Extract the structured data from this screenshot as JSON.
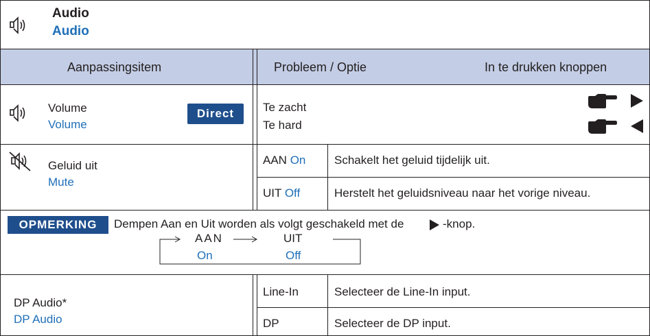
{
  "section": {
    "title": "Audio",
    "title_translation": "Audio"
  },
  "table_headers": {
    "adjustment_item": "Aanpassingsitem",
    "problem_option": "Probleem / Optie",
    "buttons": "In te drukken knoppen"
  },
  "volume": {
    "label": "Volume",
    "label_translation": "Volume",
    "direct_badge": "Direct",
    "options": [
      "Te zacht",
      "Te hard"
    ],
    "icons": [
      "pointing-hand-icon",
      "triangle-right-icon",
      "pointing-hand-icon",
      "triangle-left-icon"
    ]
  },
  "mute": {
    "label": "Geluid uit",
    "label_translation": "Mute",
    "rows": [
      {
        "option": "AAN",
        "option_translation": "On",
        "description": "Schakelt het geluid tijdelijk uit."
      },
      {
        "option": "UIT",
        "option_translation": "Off",
        "description": "Herstelt het geluidsniveau naar het vorige niveau."
      }
    ]
  },
  "note": {
    "badge": "OPMERKING",
    "text_before": "Dempen Aan en Uit worden als volgt geschakeld met de",
    "text_after": "-knop.",
    "cycle": [
      {
        "label": "AAN",
        "translation": "On"
      },
      {
        "label": "UIT",
        "translation": "Off"
      }
    ]
  },
  "dp_audio": {
    "label": "DP Audio*",
    "label_translation": "DP Audio",
    "rows": [
      {
        "option": "Line-In",
        "description": "Selecteer de Line-In input."
      },
      {
        "option": "DP",
        "description": "Selecteer de DP input."
      }
    ]
  },
  "colors": {
    "header_bg": "#c3cde5",
    "accent_blue": "#1f6fb8",
    "badge_bg": "#1f4e8c",
    "text": "#231f20"
  }
}
